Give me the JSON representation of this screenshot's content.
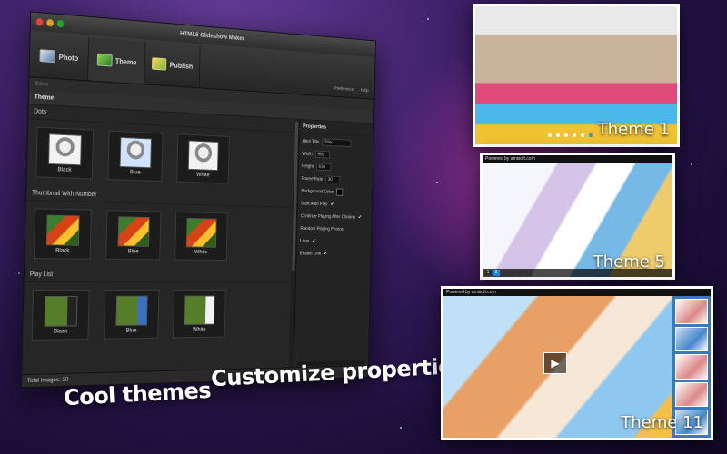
{
  "window": {
    "title": "HTML5 Slideshow Maker"
  },
  "toolbar": {
    "tabs": [
      {
        "label": "Photo",
        "icon": "photo-icon"
      },
      {
        "label": "Theme",
        "icon": "theme-icon"
      },
      {
        "label": "Publish",
        "icon": "publish-icon"
      }
    ],
    "right_links": [
      "Preference",
      "Help"
    ]
  },
  "subbar": {
    "label": "Basic"
  },
  "theme_bar": {
    "label": "Theme"
  },
  "sections": [
    {
      "title": "Dots",
      "items": [
        "Black",
        "Blue",
        "White"
      ]
    },
    {
      "title": "Thumbnail With Number",
      "items": [
        "Black",
        "Blue",
        "White"
      ]
    },
    {
      "title": "Play List",
      "items": [
        "Black",
        "Blue",
        "White"
      ]
    }
  ],
  "properties": {
    "title": "Properties",
    "html_title_label": "Html Title",
    "html_title_value": "Title",
    "width_label": "Width",
    "width_value": "905",
    "height_label": "Height",
    "height_value": "610",
    "frame_rate_label": "Frame Rate",
    "frame_rate_value": "30",
    "background_color_label": "Background Color",
    "background_color": "#000000",
    "checks": [
      {
        "label": "Start Auto Play",
        "checked": true
      },
      {
        "label": "Continue Playing After Clicking",
        "checked": true
      },
      {
        "label": "Random Playing Photos",
        "checked": false
      },
      {
        "label": "Loop",
        "checked": true
      },
      {
        "label": "Enable Link",
        "checked": true
      }
    ],
    "check_mark": "✔"
  },
  "status": {
    "total_images": "Total Images: 20"
  },
  "captions": {
    "left": "Cool themes",
    "right": "Customize properties"
  },
  "previews": {
    "theme1": {
      "label": "Theme 1"
    },
    "theme5": {
      "label": "Theme 5",
      "powered": "Powered by amisoft.com",
      "numbers": [
        "1",
        "2"
      ]
    },
    "theme11": {
      "label": "Theme 11",
      "powered": "Powered by amisoft.com"
    }
  }
}
